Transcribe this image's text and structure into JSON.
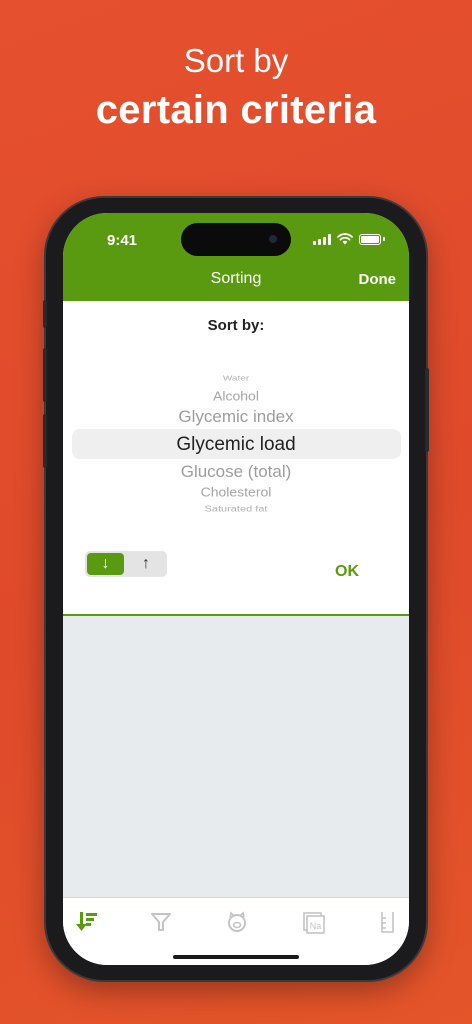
{
  "headline": {
    "line1": "Sort by",
    "line2": "certain criteria"
  },
  "status_bar": {
    "time": "9:41"
  },
  "nav": {
    "title": "Sorting",
    "done_label": "Done"
  },
  "sort": {
    "label": "Sort by:",
    "picker_items": [
      "Water",
      "Alcohol",
      "Glycemic index",
      "Glycemic load",
      "Glucose (total)",
      "Cholesterol",
      "Saturated fat"
    ],
    "selected": "Glycemic load",
    "order_options": {
      "descending": "↓",
      "ascending": "↑"
    },
    "selected_order": "descending",
    "ok_label": "OK"
  },
  "tabs": [
    {
      "icon": "sort-icon",
      "active": true
    },
    {
      "icon": "filter-icon",
      "active": false
    },
    {
      "icon": "piggy-bank-icon",
      "active": false
    },
    {
      "icon": "sodium-icon",
      "active": false,
      "text": "Na"
    },
    {
      "icon": "measuring-cup-icon",
      "active": false
    }
  ],
  "colors": {
    "accent": "#5a9a10",
    "background": "#df4a2b",
    "tab_inactive": "#c4c4c4"
  }
}
